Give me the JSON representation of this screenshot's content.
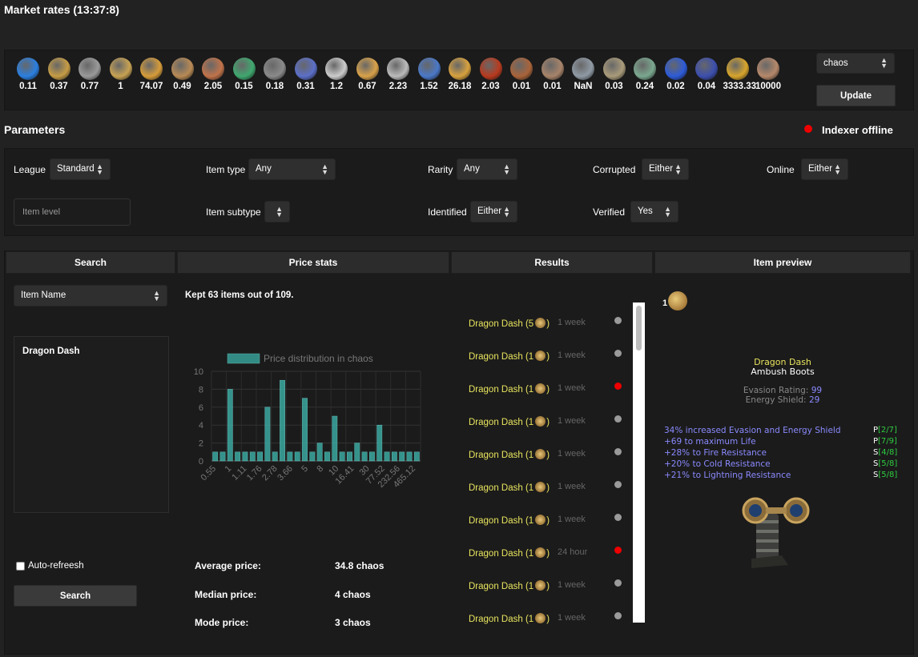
{
  "header": {
    "title": "Market rates (13:37:8)"
  },
  "rates": {
    "items": [
      {
        "icon": "shard-blue-icon",
        "value": "0.11",
        "color": "#2a7fe0"
      },
      {
        "icon": "orb-gold-icon",
        "value": "0.37",
        "color": "#c69c45"
      },
      {
        "icon": "chain-icon",
        "value": "0.77",
        "color": "#9a9a9a"
      },
      {
        "icon": "chaos-orb-icon",
        "value": "1",
        "color": "#c7a253"
      },
      {
        "icon": "mask-icon",
        "value": "74.07",
        "color": "#d69c3a"
      },
      {
        "icon": "wand-icon",
        "value": "0.49",
        "color": "#b88a55"
      },
      {
        "icon": "prism-icon",
        "value": "2.05",
        "color": "#c0734a"
      },
      {
        "icon": "crystal-icon",
        "value": "0.15",
        "color": "#3fa86f"
      },
      {
        "icon": "ring-icon",
        "value": "0.18",
        "color": "#8a8a8a"
      },
      {
        "icon": "claw-icon",
        "value": "0.31",
        "color": "#5b6fc8"
      },
      {
        "icon": "sphere-icon",
        "value": "1.2",
        "color": "#cccccc"
      },
      {
        "icon": "coin-icon",
        "value": "0.67",
        "color": "#d9a24a"
      },
      {
        "icon": "silver-orb-icon",
        "value": "2.23",
        "color": "#bbbbbb"
      },
      {
        "icon": "vial-icon",
        "value": "1.52",
        "color": "#4a78c8"
      },
      {
        "icon": "golden-mask-icon",
        "value": "26.18",
        "color": "#d8a23e"
      },
      {
        "icon": "red-orb-icon",
        "value": "2.03",
        "color": "#b83a1e"
      },
      {
        "icon": "staff-icon",
        "value": "0.01",
        "color": "#a9643a"
      },
      {
        "icon": "bone-icon",
        "value": "0.01",
        "color": "#a7846a"
      },
      {
        "icon": "stone-icon",
        "value": "NaN",
        "color": "#8f9aa5"
      },
      {
        "icon": "feather-icon",
        "value": "0.03",
        "color": "#a99b7a"
      },
      {
        "icon": "egg-icon",
        "value": "0.24",
        "color": "#7aa88f"
      },
      {
        "icon": "blue-claw-icon",
        "value": "0.02",
        "color": "#2d5bd8"
      },
      {
        "icon": "dark-orb-icon",
        "value": "0.04",
        "color": "#3c4fae"
      },
      {
        "icon": "exalted-orb-icon",
        "value": "3333.33",
        "color": "#d7a52c"
      },
      {
        "icon": "mirror-icon",
        "value": "10000",
        "color": "#b5886a"
      }
    ],
    "currency_select": "chaos",
    "update_label": "Update"
  },
  "parameters": {
    "title": "Parameters",
    "indexer_status": "Indexer offline",
    "league_label": "League",
    "league_value": "Standard",
    "item_type_label": "Item type",
    "item_type_value": "Any",
    "rarity_label": "Rarity",
    "rarity_value": "Any",
    "corrupted_label": "Corrupted",
    "corrupted_value": "Either",
    "online_label": "Online",
    "online_value": "Either",
    "item_level_placeholder": "Item level",
    "item_subtype_label": "Item subtype",
    "item_subtype_value": "",
    "identified_label": "Identified",
    "identified_value": "Either",
    "verified_label": "Verified",
    "verified_value": "Yes"
  },
  "tabs": [
    "Search",
    "Price stats",
    "Results",
    "Item preview"
  ],
  "search": {
    "mode_select": "Item Name",
    "query": "Dragon Dash",
    "auto_refresh_label": "Auto-refreesh",
    "search_button": "Search"
  },
  "price_stats": {
    "kept_text": "Kept 63 items out of 109.",
    "average_label": "Average price:",
    "average_value": "34.8 chaos",
    "median_label": "Median price:",
    "median_value": "4 chaos",
    "mode_label": "Mode price:",
    "mode_value": "3 chaos"
  },
  "chart_data": {
    "type": "bar",
    "title": "",
    "legend": "Price distribution in chaos",
    "x_tick_labels": [
      "0.55",
      "1",
      "1.11",
      "1.76",
      "2.78",
      "3.66",
      "5",
      "8",
      "10",
      "16.41",
      "30",
      "77.52",
      "232.56",
      "465.12"
    ],
    "values": [
      1,
      1,
      8,
      1,
      1,
      1,
      1,
      6,
      1,
      9,
      1,
      1,
      7,
      1,
      2,
      1,
      5,
      1,
      1,
      2,
      1,
      1,
      4,
      1,
      1,
      1,
      1,
      1
    ],
    "ylim": [
      0,
      10
    ],
    "yticks": [
      0,
      2,
      4,
      6,
      8,
      10
    ],
    "bar_color": "#3aa8a0",
    "grid": true
  },
  "results": {
    "items": [
      {
        "name": "Dragon Dash (5",
        "icon": "shard-blue-icon",
        "time": "1 week",
        "status": "gray"
      },
      {
        "name": "Dragon Dash (1",
        "icon": "wand-icon",
        "time": "1 week",
        "status": "gray"
      },
      {
        "name": "Dragon Dash (1",
        "icon": "chaos-orb-icon",
        "time": "1 week",
        "status": "red"
      },
      {
        "name": "Dragon Dash (1",
        "icon": "chaos-orb-icon",
        "time": "1 week",
        "status": "gray"
      },
      {
        "name": "Dragon Dash (1",
        "icon": "chaos-orb-icon",
        "time": "1 week",
        "status": "gray"
      },
      {
        "name": "Dragon Dash (1",
        "icon": "chaos-orb-icon",
        "time": "1 week",
        "status": "gray"
      },
      {
        "name": "Dragon Dash (1",
        "icon": "chaos-orb-icon",
        "time": "1 week",
        "status": "gray"
      },
      {
        "name": "Dragon Dash (1",
        "icon": "chaos-orb-icon",
        "time": "24 hour",
        "status": "red"
      },
      {
        "name": "Dragon Dash (1",
        "icon": "chaos-orb-icon",
        "time": "1 week",
        "status": "gray"
      },
      {
        "name": "Dragon Dash (1",
        "icon": "chaos-orb-icon",
        "time": "1 week",
        "status": "gray"
      }
    ]
  },
  "preview": {
    "price": "1",
    "name": "Dragon Dash",
    "base": "Ambush Boots",
    "evasion_label": "Evasion Rating:",
    "evasion_value": "99",
    "es_label": "Energy Shield:",
    "es_value": "29",
    "mods": [
      {
        "text": "34% increased Evasion and Energy Shield",
        "tag": "P",
        "roll": "[2/7]"
      },
      {
        "text": "+69 to maximum Life",
        "tag": "P",
        "roll": "[7/9]"
      },
      {
        "text": "+28% to Fire Resistance",
        "tag": "S",
        "roll": "[4/8]"
      },
      {
        "text": "+20% to Cold Resistance",
        "tag": "S",
        "roll": "[5/8]"
      },
      {
        "text": "+21% to Lightning Resistance",
        "tag": "S",
        "roll": "[5/8]"
      }
    ]
  }
}
